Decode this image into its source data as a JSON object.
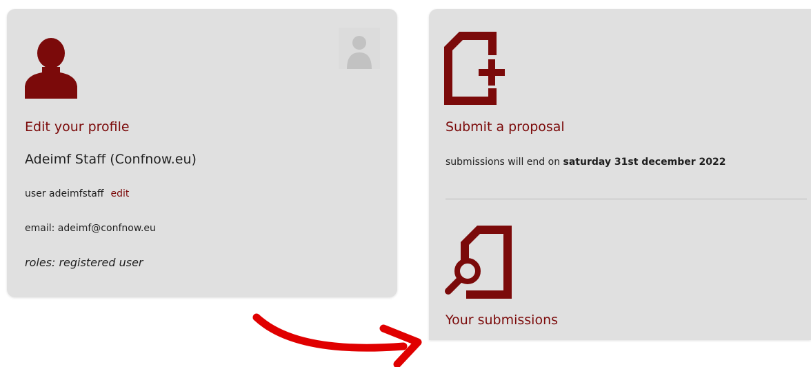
{
  "profile": {
    "edit_profile_label": "Edit your profile",
    "full_name": "Adeimf Staff (Confnow.eu)",
    "username_text": "user adeimfstaff",
    "username_edit_label": "edit",
    "email_text": "email: adeimf@confnow.eu",
    "roles_text": "roles: registered user",
    "icon": "user-icon",
    "avatar_icon": "avatar-placeholder-icon"
  },
  "actions": {
    "submit_label": "Submit a proposal",
    "submit_icon": "document-plus-icon",
    "deadline_prefix": "submissions will end on",
    "deadline_date": "saturday 31st december 2022",
    "submissions_label": "Your submissions",
    "submissions_icon": "document-search-icon"
  },
  "annotation": {
    "arrow_icon": "red-arrow-icon",
    "arrow_color": "#e00000"
  },
  "colors": {
    "accent": "#7b0a0a",
    "card_bg": "#e0e0e0",
    "text": "#1f1f1f"
  }
}
